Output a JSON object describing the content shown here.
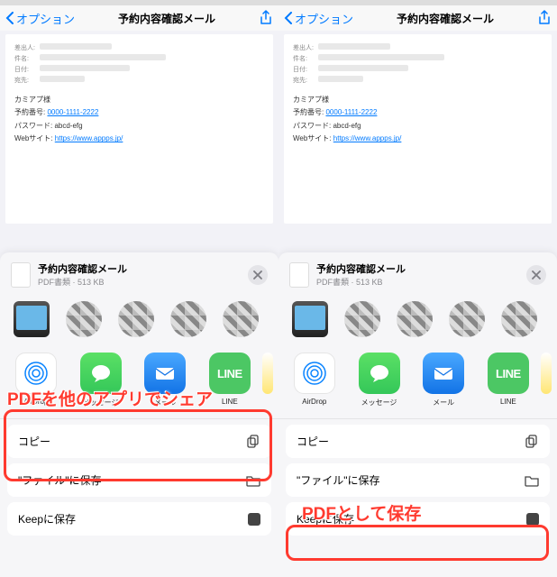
{
  "nav": {
    "back_label": "オプション",
    "title": "予約内容確認メール"
  },
  "mail": {
    "hdr_sender": "差出人:",
    "hdr_subject": "件名:",
    "hdr_date": "日付:",
    "hdr_to": "宛先:",
    "greeting": "カミアプ様",
    "line1_label": "予約番号:",
    "line1_link": "0000-1111-2222",
    "line2": "パスワード: abcd-efg",
    "line3_label": "Webサイト:",
    "line3_link": "https://www.appps.jp/"
  },
  "sheet": {
    "title": "予約内容確認メール",
    "sub": "PDF書類 · 513 KB"
  },
  "apps": {
    "airdrop": "AirDrop",
    "messages": "メッセージ",
    "mail": "メール",
    "line": "LINE"
  },
  "actions": {
    "copy": "コピー",
    "save_files": "\"ファイル\"に保存",
    "keep": "Keepに保存"
  },
  "annotations": {
    "share_other_apps": "PDFを他のアプリでシェア",
    "save_as_pdf": "PDFとして保存"
  }
}
